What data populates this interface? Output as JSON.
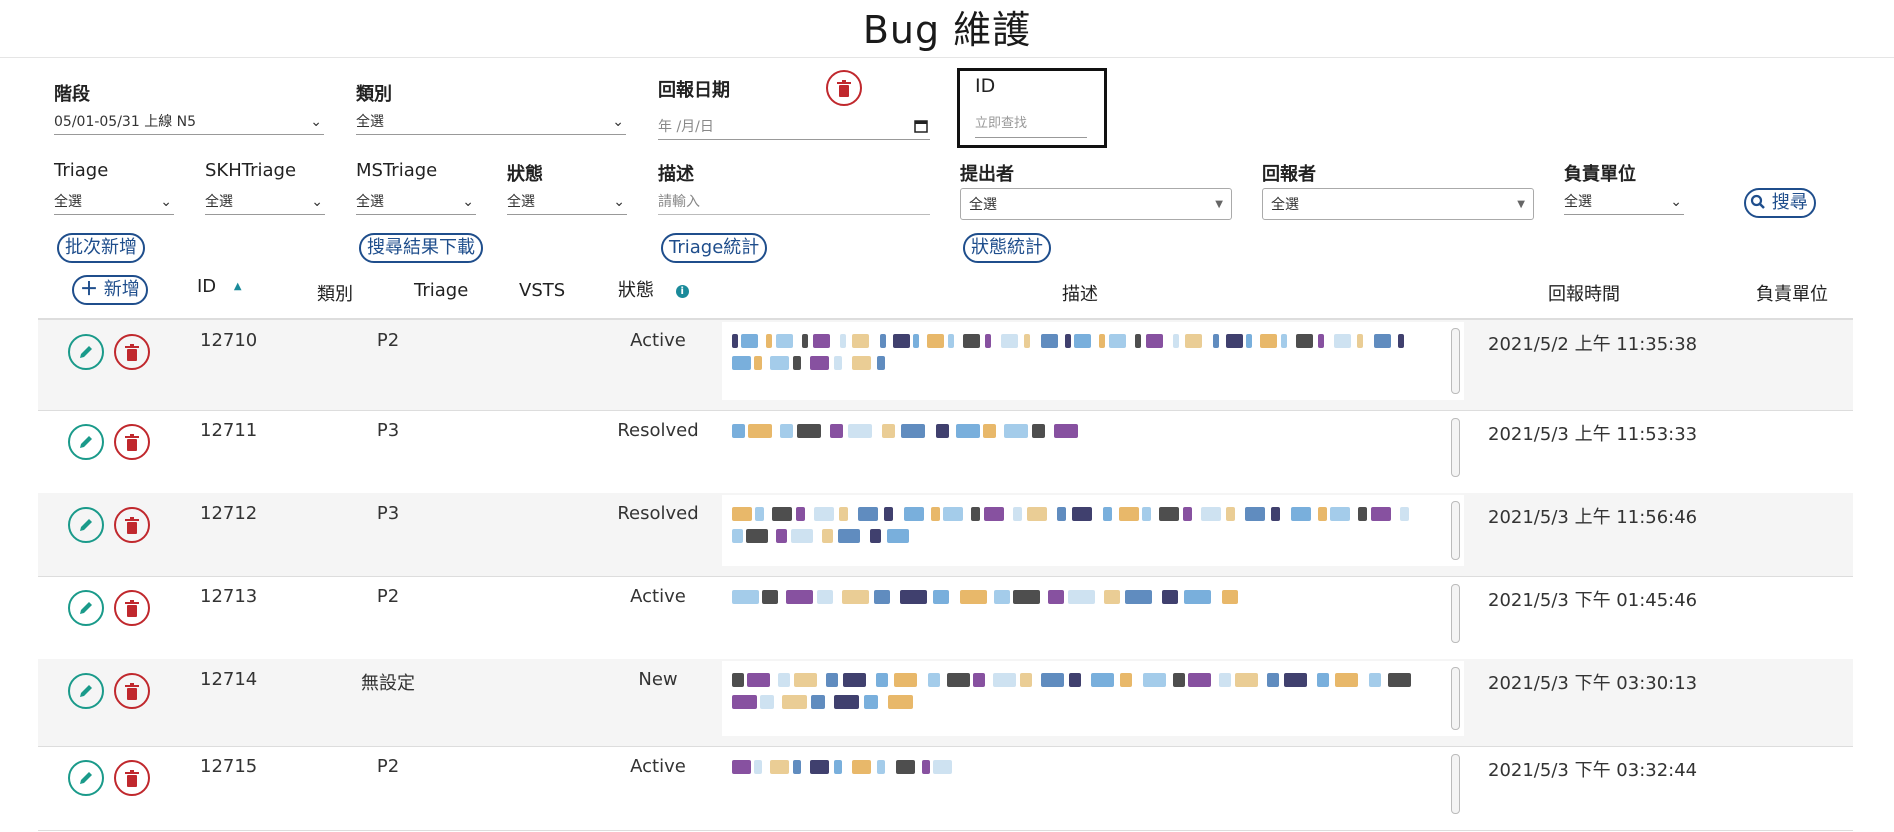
{
  "page": {
    "title": "Bug 維護"
  },
  "filters": {
    "stage": {
      "label": "階段",
      "value": "05/01-05/31 上線 N5"
    },
    "category": {
      "label": "類別",
      "value": "全選"
    },
    "report_date": {
      "label": "回報日期",
      "placeholder": "年 /月/日"
    },
    "id": {
      "label": "ID",
      "placeholder": "立即查找"
    },
    "triage": {
      "label": "Triage",
      "value": "全選"
    },
    "skh_triage": {
      "label": "SKHTriage",
      "value": "全選"
    },
    "ms_triage": {
      "label": "MSTriage",
      "value": "全選"
    },
    "status": {
      "label": "狀態",
      "value": "全選"
    },
    "description": {
      "label": "描述",
      "placeholder": "請輸入"
    },
    "submitter": {
      "label": "提出者",
      "value": "全選"
    },
    "reporter": {
      "label": "回報者",
      "value": "全選"
    },
    "owner_unit": {
      "label": "負責單位",
      "value": "全選"
    }
  },
  "buttons": {
    "search": "搜尋",
    "batch_add": "批次新增",
    "download_results": "搜尋結果下載",
    "triage_stats": "Triage統計",
    "status_stats": "狀態統計",
    "add": "新增"
  },
  "table": {
    "headers": {
      "id": "ID",
      "category": "類別",
      "triage": "Triage",
      "vsts": "VSTS",
      "status": "狀態",
      "description": "描述",
      "report_time": "回報時間",
      "owner_unit": "負責單位"
    },
    "rows": [
      {
        "id": "12710",
        "triage": "P2",
        "status": "Active",
        "time": "2021/5/2 上午 11:35:38"
      },
      {
        "id": "12711",
        "triage": "P3",
        "status": "Resolved",
        "time": "2021/5/3 上午 11:53:33"
      },
      {
        "id": "12712",
        "triage": "P3",
        "status": "Resolved",
        "time": "2021/5/3 上午 11:56:46"
      },
      {
        "id": "12713",
        "triage": "P2",
        "status": "Active",
        "time": "2021/5/3 下午 01:45:46"
      },
      {
        "id": "12714",
        "triage": "無設定",
        "status": "New",
        "time": "2021/5/3 下午 03:30:13"
      },
      {
        "id": "12715",
        "triage": "P2",
        "status": "Active",
        "time": "2021/5/3 下午 03:32:44"
      }
    ]
  },
  "colors": {
    "accent": "#1f4e8c",
    "danger": "#c0282d",
    "edit": "#1a9a8a",
    "info": "#1a8a9a"
  }
}
